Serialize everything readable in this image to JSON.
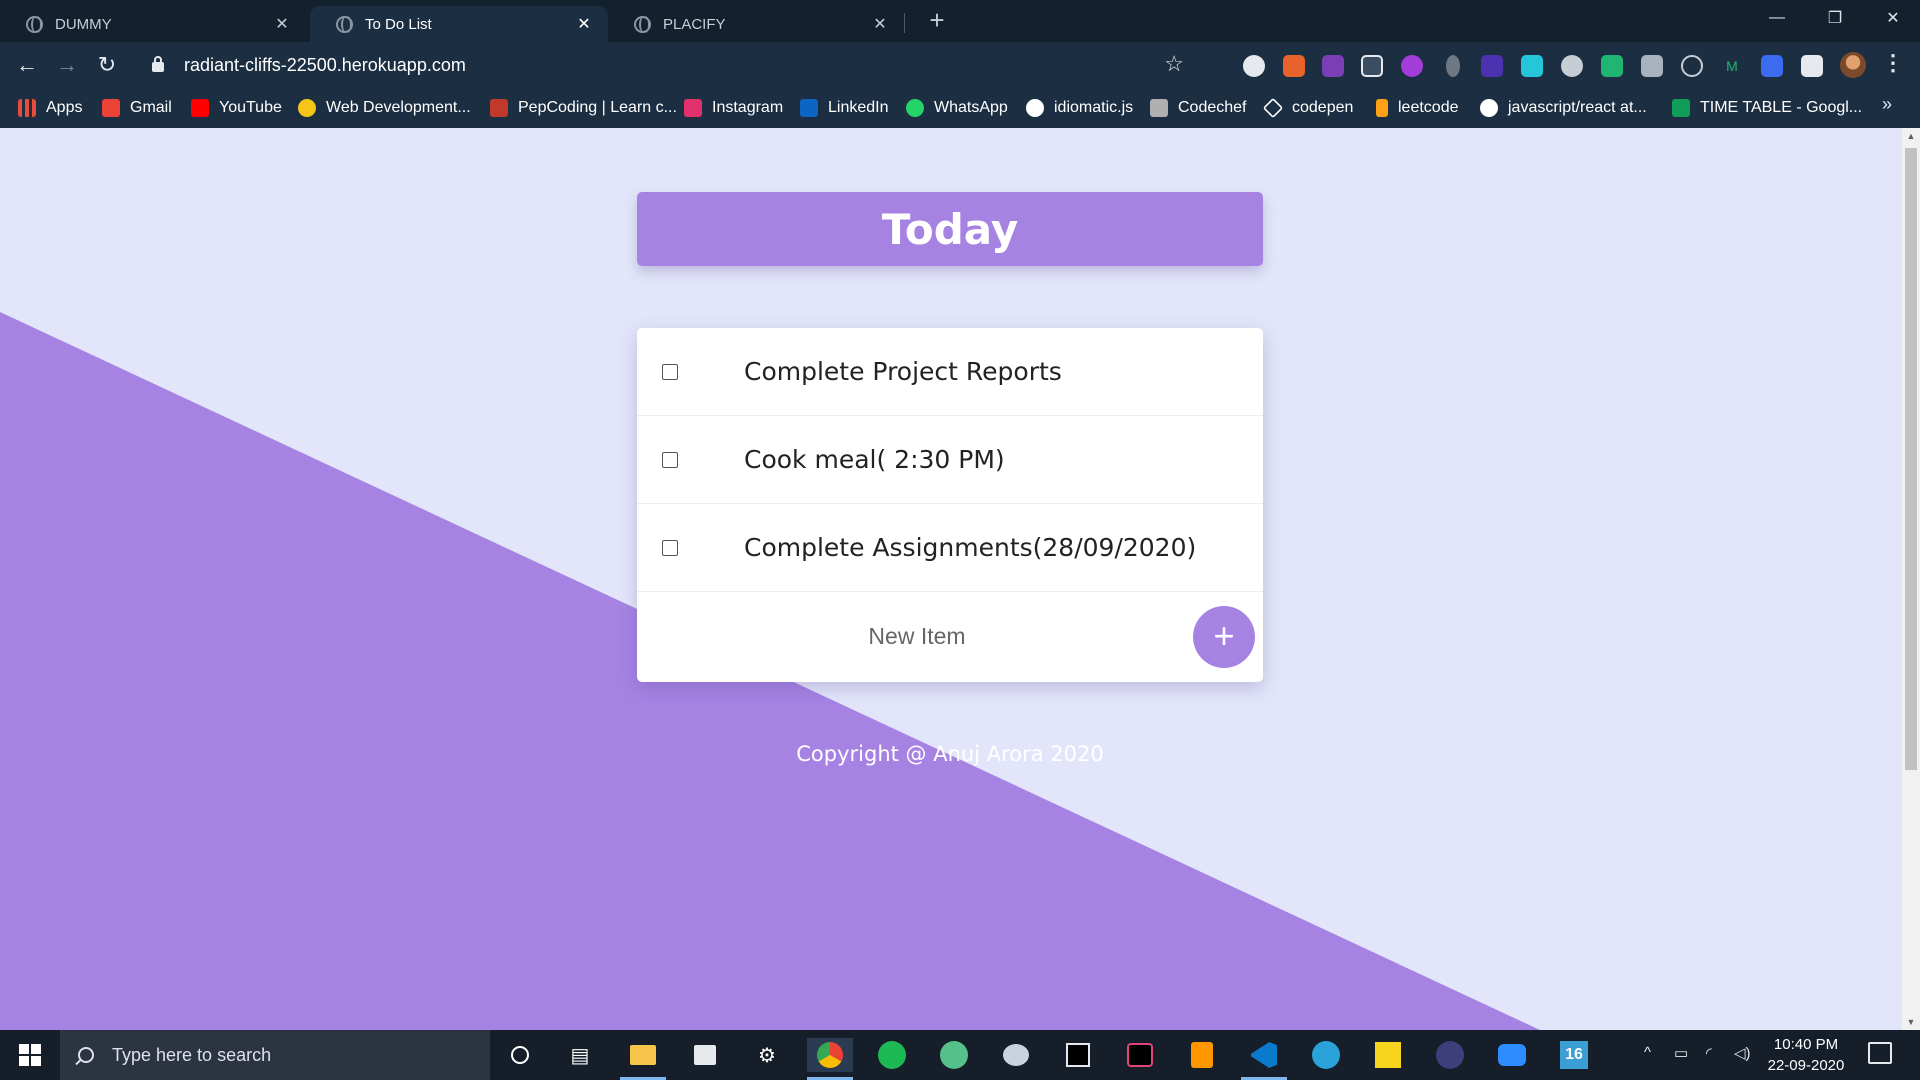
{
  "browser": {
    "tabs": [
      {
        "title": "DUMMY",
        "active": false
      },
      {
        "title": "To Do List",
        "active": true
      },
      {
        "title": "PLACIFY",
        "active": false
      }
    ],
    "tab_close_glyph": "✕",
    "new_tab_glyph": "+",
    "url": "radiant-cliffs-22500.herokuapp.com",
    "window_controls": {
      "minimize": "—",
      "restore": "❐",
      "close": "✕"
    }
  },
  "bookmarks": [
    {
      "label": "Apps",
      "icon": "apps-grid-icon",
      "color": "#E84C3D"
    },
    {
      "label": "Gmail",
      "icon": "gmail-icon",
      "color": "#EA4335"
    },
    {
      "label": "YouTube",
      "icon": "youtube-icon",
      "color": "#FF0000"
    },
    {
      "label": "Web Development...",
      "icon": "bookmark-site-icon",
      "color": "#F5C518"
    },
    {
      "label": "PepCoding | Learn c...",
      "icon": "pepcoding-icon",
      "color": "#C0392B"
    },
    {
      "label": "Instagram",
      "icon": "instagram-icon",
      "color": "#E1306C"
    },
    {
      "label": "LinkedIn",
      "icon": "linkedin-icon",
      "color": "#0A66C2"
    },
    {
      "label": "WhatsApp",
      "icon": "whatsapp-icon",
      "color": "#25D366"
    },
    {
      "label": "idiomatic.js",
      "icon": "github-icon",
      "color": "#FFFFFF"
    },
    {
      "label": "Codechef",
      "icon": "codechef-icon",
      "color": "#B0B0B0"
    },
    {
      "label": "codepen",
      "icon": "codepen-icon",
      "color": "#FFFFFF"
    },
    {
      "label": "leetcode",
      "icon": "leetcode-icon",
      "color": "#FFA116"
    },
    {
      "label": "javascript/react at...",
      "icon": "github-icon",
      "color": "#FFFFFF"
    },
    {
      "label": "TIME TABLE - Googl...",
      "icon": "google-sheets-icon",
      "color": "#0F9D58"
    }
  ],
  "bookmarks_more": "»",
  "page": {
    "heading": "Today",
    "items": [
      {
        "label": "Complete Project Reports",
        "checked": false
      },
      {
        "label": "Cook meal( 2:30 PM)",
        "checked": false
      },
      {
        "label": "Complete Assignments(28/09/2020)",
        "checked": false
      }
    ],
    "new_item_placeholder": "New Item",
    "add_button": "+",
    "footer": "Copyright @ Anuj Arora 2020"
  },
  "colors": {
    "accent": "#A683E3",
    "background": "#E3E6FA",
    "browser_dark": "#1C2E42"
  },
  "taskbar": {
    "search_placeholder": "Type here to search",
    "time": "10:40 PM",
    "date": "22-09-2020"
  }
}
